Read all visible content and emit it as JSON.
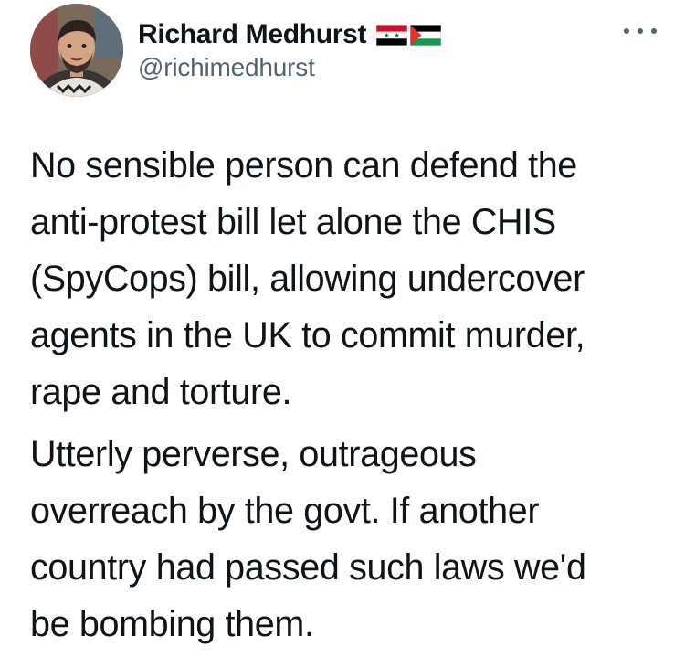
{
  "author": {
    "display_name": "Richard Medhurst",
    "handle": "@richimedhurst",
    "avatar_icon": "profile-photo",
    "flags": [
      {
        "icon": "syria-flag-icon",
        "colors": [
          "#ce1126",
          "#ffffff",
          "#000000",
          "#007a3d"
        ]
      },
      {
        "icon": "palestine-flag-icon",
        "colors": [
          "#000000",
          "#ffffff",
          "#149954",
          "#e4312b"
        ]
      }
    ]
  },
  "menu": {
    "icon": "more-options-icon"
  },
  "tweet": {
    "paragraphs": [
      {
        "lines": [
          "No sensible person can defend the",
          "anti-protest bill let alone the CHIS",
          "(SpyCops) bill, allowing undercover",
          "agents in the UK to commit murder,",
          "rape and torture."
        ]
      },
      {
        "lines": [
          "Utterly perverse, outrageous",
          "overreach by the govt. If another",
          "country had passed such laws we'd",
          "be bombing them."
        ]
      }
    ]
  }
}
